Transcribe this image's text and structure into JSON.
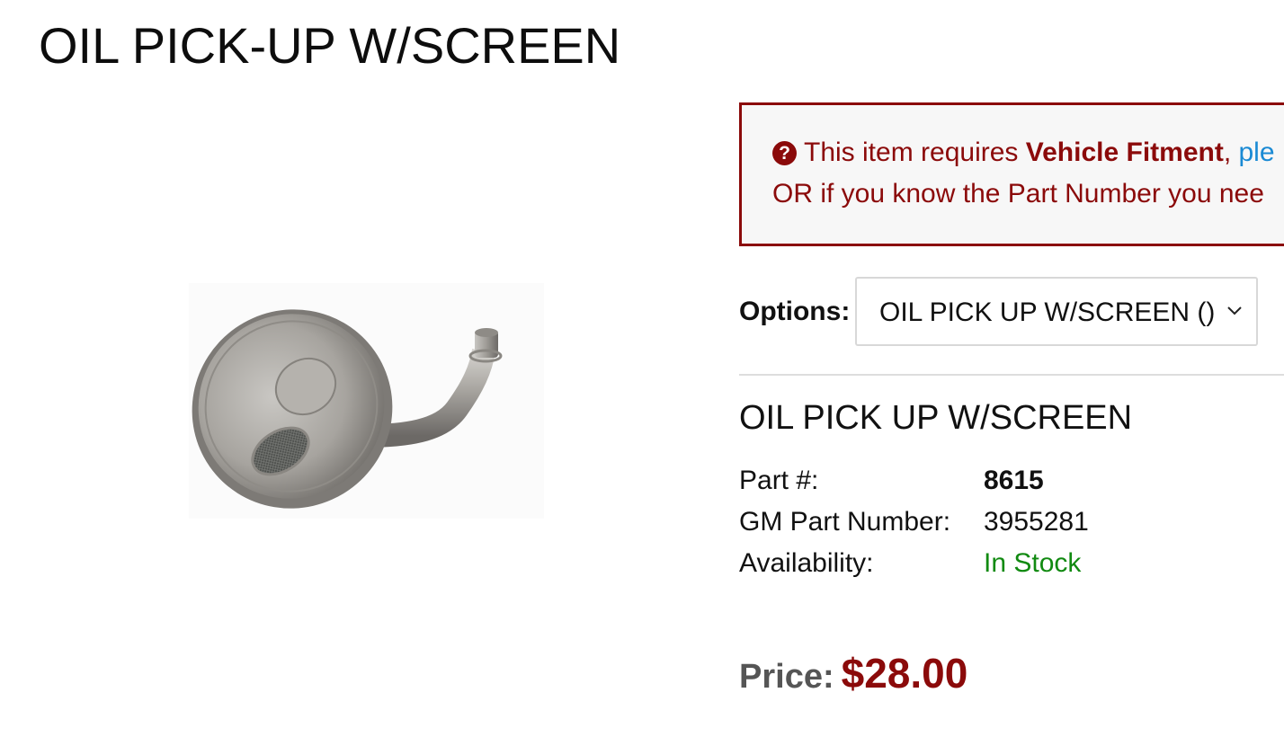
{
  "page": {
    "title": "OIL PICK-UP W/SCREEN"
  },
  "product_image": {
    "alt": "Oil pick-up tube with screen"
  },
  "fitment_notice": {
    "icon": "question-circle-icon",
    "line1_prefix": "This item requires ",
    "line1_strong": "Vehicle Fitment",
    "line1_sep": ", ",
    "line1_link": "ple",
    "line2": "OR if you know the Part Number you nee",
    "color": "#8b0a0a",
    "link_color": "#1a8ad4"
  },
  "options": {
    "label": "Options:",
    "selected": "OIL PICK UP W/SCREEN ()"
  },
  "variant": {
    "title": "OIL PICK UP W/SCREEN",
    "specs": [
      {
        "label": "Part #:",
        "value": "8615"
      },
      {
        "label": "GM Part Number:",
        "value": "3955281"
      },
      {
        "label": "Availability:",
        "value": "In Stock"
      }
    ],
    "availability_color": "#118a11"
  },
  "price": {
    "label": "Price:",
    "value": "$28.00"
  }
}
